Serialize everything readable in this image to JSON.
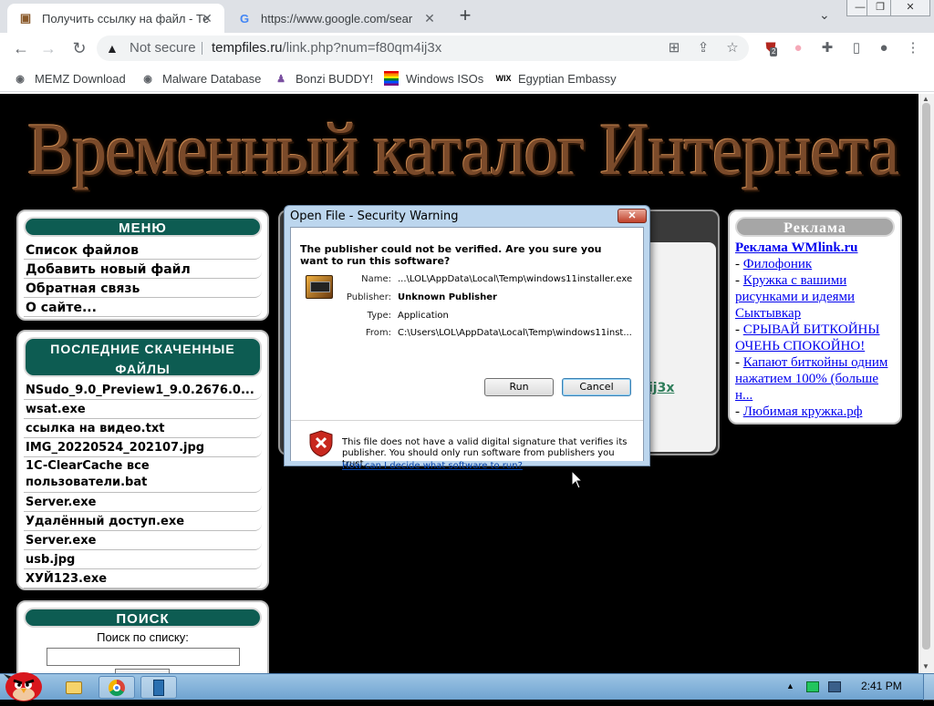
{
  "browser": {
    "tabs": [
      {
        "title": "Получить ссылку на файл - Те",
        "active": true
      },
      {
        "title": "https://www.google.com/sear",
        "active": false
      }
    ],
    "address": {
      "security_label": "Not secure",
      "host": "tempfiles.ru",
      "path": "/link.php?num=f80qm4ij3x"
    },
    "extension_badge": "2",
    "bookmarks": [
      {
        "label": "MEMZ Download"
      },
      {
        "label": "Malware Database"
      },
      {
        "label": "Bonzi BUDDY!"
      },
      {
        "label": "Windows ISOs"
      },
      {
        "label": "Egyptian Embassy"
      }
    ]
  },
  "page": {
    "banner_title": "Временный каталог Интернета",
    "menu": {
      "title": "МЕНЮ",
      "items": [
        "Список файлов",
        "Добавить новый файл",
        "Обратная связь",
        "О сайте..."
      ]
    },
    "recent": {
      "title": "ПОСЛЕДНИЕ СКАЧЕННЫЕ ФАЙЛЫ",
      "items": [
        "NSudo_9.0_Preview1_9.0.2676.0...",
        "wsat.exe",
        "ссылка на видео.txt",
        "IMG_20220524_202107.jpg",
        "1C-ClearCache все пользователи.bat",
        "Server.exe",
        "Удалённый доступ.exe",
        "Server.exe",
        "usb.jpg",
        "ХУЙ123.exe"
      ]
    },
    "search": {
      "title": "ПОИСК",
      "label": "Поиск по списку:",
      "value": ""
    },
    "center_partial_link": "ij3x",
    "ads": {
      "title": "Реклама",
      "headline": "Реклама WMlink.ru",
      "items": [
        "Филофоник",
        "Кружка с вашими рисунками и идеями Сыктывкар",
        "СРЫВАЙ БИТКОЙНЫ ОЧЕНЬ СПОКОЙНО!",
        "Капают биткойны одним нажатием 100% (больше н...",
        "Любимая кружка.рф"
      ]
    }
  },
  "dialog": {
    "title": "Open File - Security Warning",
    "close_label": "✕",
    "question": "The publisher could not be verified.  Are you sure you want to run this software?",
    "fields": [
      {
        "key": "Name:",
        "value": "...\\LOL\\AppData\\Local\\Temp\\windows11installer.exe"
      },
      {
        "key": "Publisher:",
        "value": "Unknown Publisher"
      },
      {
        "key": "Type:",
        "value": "Application"
      },
      {
        "key": "From:",
        "value": "C:\\Users\\LOL\\AppData\\Local\\Temp\\windows11inst..."
      }
    ],
    "run_label": "Run",
    "cancel_label": "Cancel",
    "footer_text": "This file does not have a valid digital signature that verifies its publisher.  You should only run software from publishers you trust.",
    "footer_link": "How can I decide what software to run?"
  },
  "taskbar": {
    "clock": "2:41 PM"
  }
}
